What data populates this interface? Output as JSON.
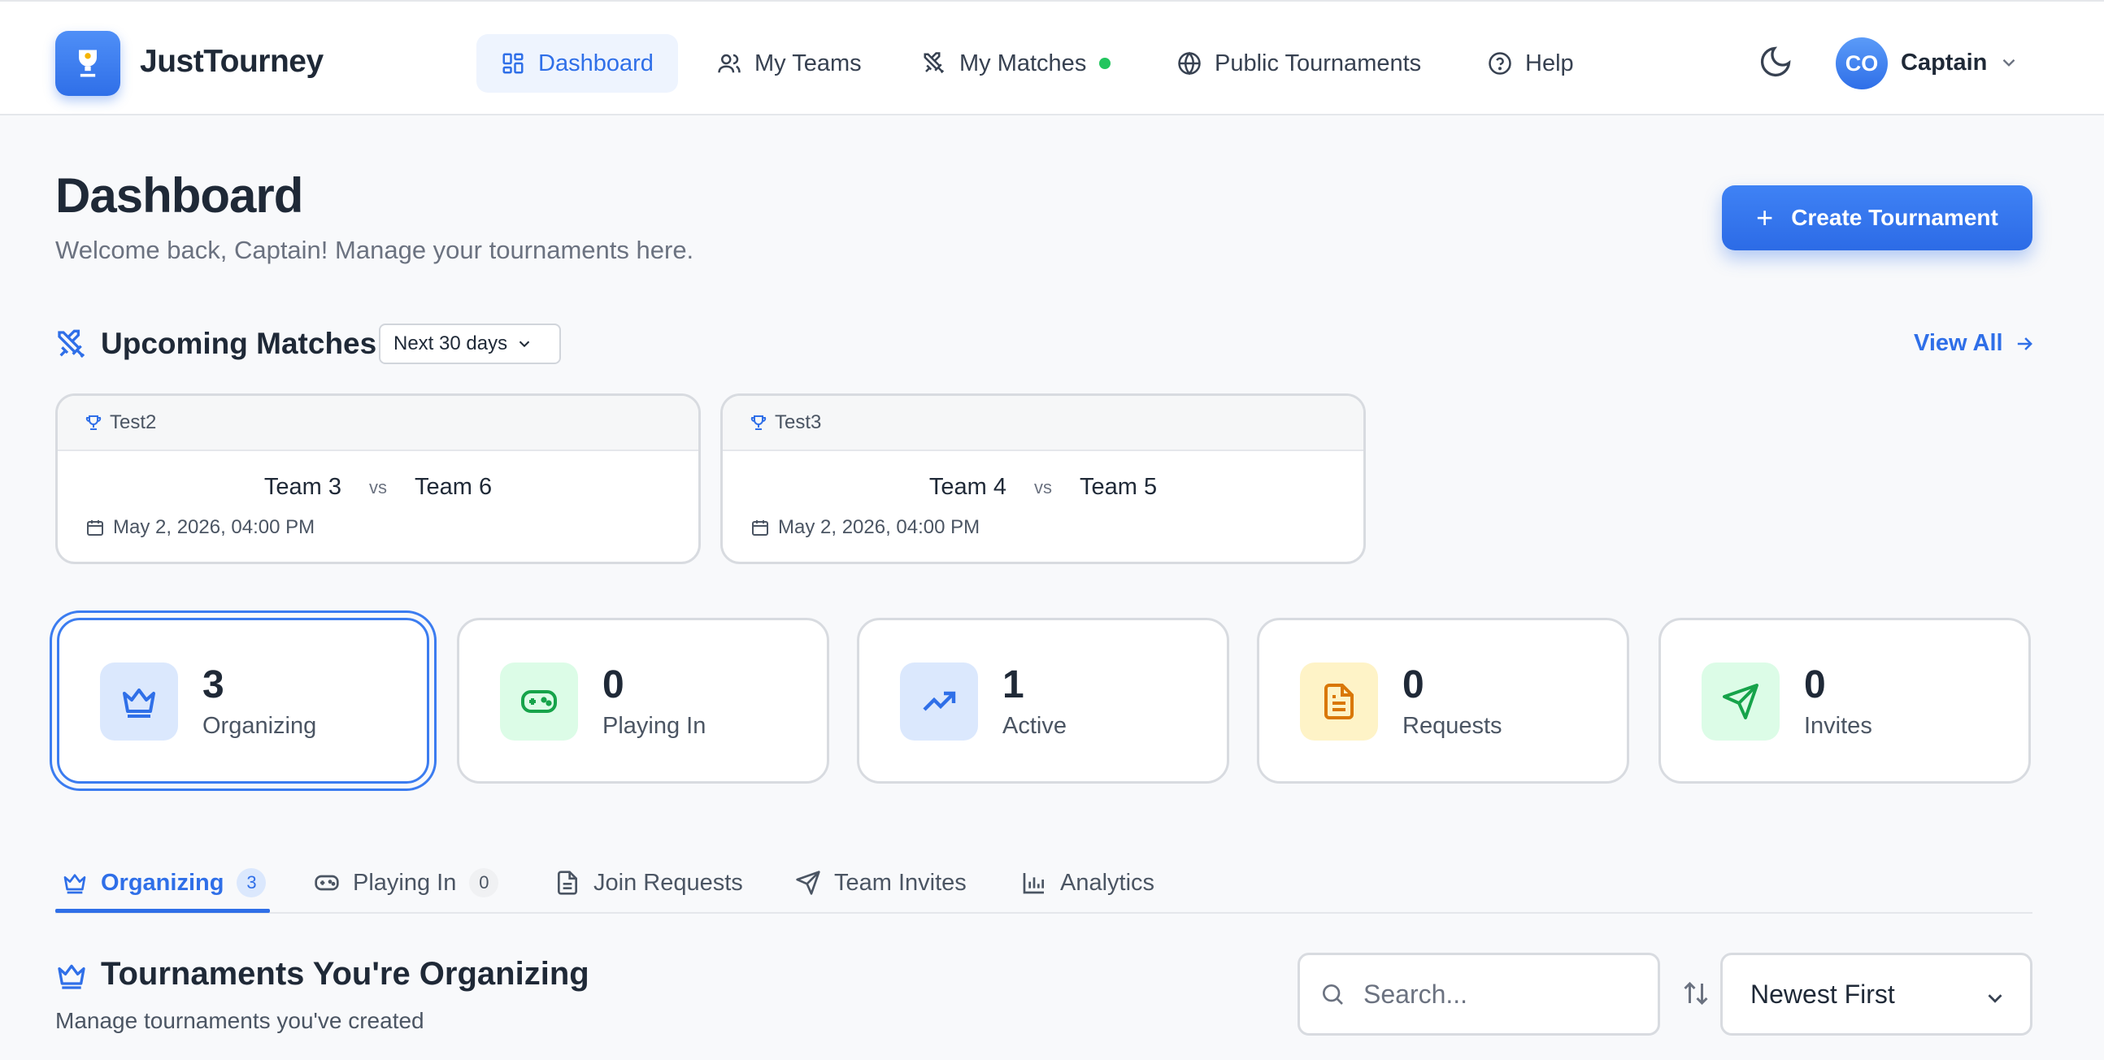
{
  "app": {
    "name": "JustTourney"
  },
  "nav": {
    "items": [
      {
        "label": "Dashboard",
        "icon": "dashboard-grid-icon",
        "active": true
      },
      {
        "label": "My Teams",
        "icon": "users-icon"
      },
      {
        "label": "My Matches",
        "icon": "crossed-swords-icon",
        "indicator": "green-dot"
      },
      {
        "label": "Public Tournaments",
        "icon": "globe-icon"
      },
      {
        "label": "Help",
        "icon": "help-circle-icon"
      }
    ]
  },
  "user": {
    "initials": "CO",
    "name": "Captain"
  },
  "page": {
    "title": "Dashboard",
    "subtitle": "Welcome back, Captain! Manage your tournaments here.",
    "create_button": "Create Tournament"
  },
  "upcoming": {
    "title": "Upcoming Matches",
    "range": "Next 30 days",
    "view_all": "View All",
    "matches": [
      {
        "tournament": "Test2",
        "team_a": "Team 3",
        "vs": "vs",
        "team_b": "Team 6",
        "date": "May 2, 2026, 04:00 PM"
      },
      {
        "tournament": "Test3",
        "team_a": "Team 4",
        "vs": "vs",
        "team_b": "Team 5",
        "date": "May 2, 2026, 04:00 PM"
      }
    ]
  },
  "stats": [
    {
      "value": "3",
      "label": "Organizing",
      "icon": "crown-icon",
      "color": "#2f6fe8",
      "bg": "#dbe8fd"
    },
    {
      "value": "0",
      "label": "Playing In",
      "icon": "gamepad-icon",
      "color": "#16a34a",
      "bg": "#dcfce7"
    },
    {
      "value": "1",
      "label": "Active",
      "icon": "trending-up-icon",
      "color": "#2f6fe8",
      "bg": "#dbe8fd"
    },
    {
      "value": "0",
      "label": "Requests",
      "icon": "document-icon",
      "color": "#d97706",
      "bg": "#fef3c7"
    },
    {
      "value": "0",
      "label": "Invites",
      "icon": "send-icon",
      "color": "#16a34a",
      "bg": "#dcfce7"
    }
  ],
  "tabs": [
    {
      "label": "Organizing",
      "count": "3",
      "icon": "crown-icon",
      "active": true
    },
    {
      "label": "Playing In",
      "count": "0",
      "icon": "gamepad-icon"
    },
    {
      "label": "Join Requests",
      "icon": "document-icon"
    },
    {
      "label": "Team Invites",
      "icon": "send-icon"
    },
    {
      "label": "Analytics",
      "icon": "bar-chart-icon"
    }
  ],
  "organizing": {
    "title": "Tournaments You're Organizing",
    "subtitle": "Manage tournaments you've created",
    "search_placeholder": "Search...",
    "sort": "Newest First"
  },
  "colors": {
    "accent": "#2f6fe8",
    "online": "#22c55e"
  }
}
